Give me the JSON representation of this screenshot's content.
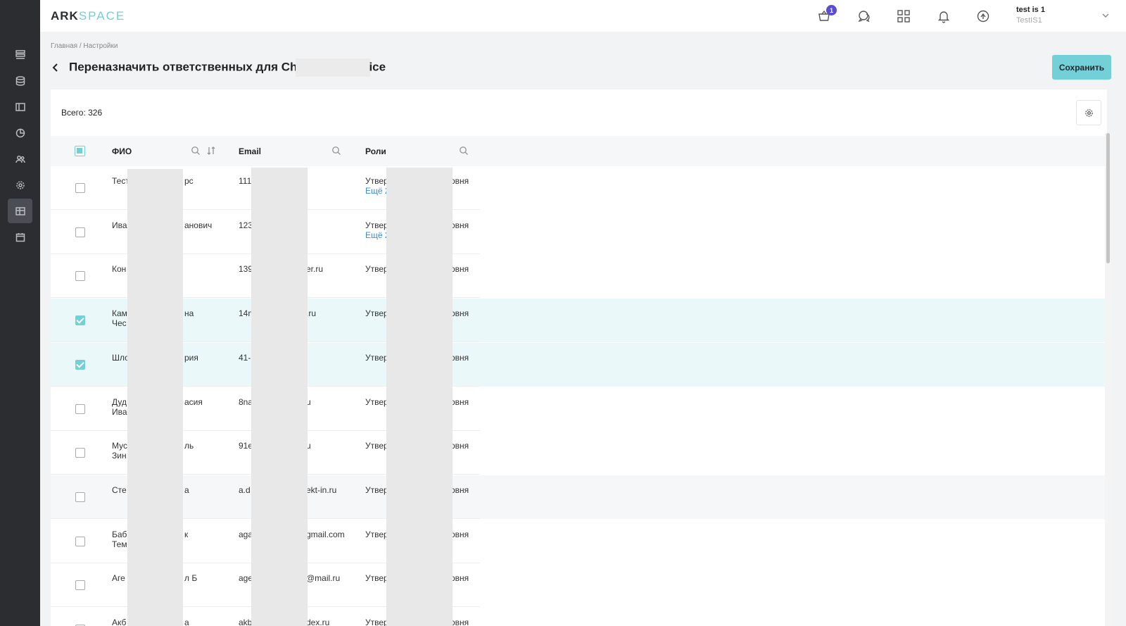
{
  "app": {
    "logo_ark": "ARK",
    "logo_space": "SPACE"
  },
  "topbar": {
    "cart_badge": "1",
    "user_name": "test is 1",
    "user_sub": "TestIS1",
    "icons": [
      "cart-icon",
      "chat-icon",
      "apps-grid-icon",
      "bell-icon",
      "sync-icon"
    ]
  },
  "breadcrumb": "Главная / Настройки",
  "page": {
    "title_start": "Переназначить ответственных для Ch",
    "title_end": "ice",
    "save_label": "Сохранить"
  },
  "table": {
    "total": "Всего: 326",
    "columns": {
      "name": "ФИО",
      "email": "Email",
      "roles": "Роли"
    },
    "rows": [
      {
        "name1": "Тест",
        "name2": "рс",
        "name3": "",
        "email1": "111",
        "email2": "",
        "role1": "Утвер",
        "role2": "овня",
        "more": "Ещё 2",
        "checked": false
      },
      {
        "name1": "Ива",
        "name2": "анович",
        "name3": "",
        "email1": "123",
        "email2": "",
        "role1": "Утвер",
        "role2": "овня",
        "more": "Ещё 2",
        "checked": false
      },
      {
        "name1": "Кон",
        "name2": "",
        "name3": "",
        "email1": "139",
        "email2": "er.ru",
        "role1": "Утвер",
        "role2": "овня",
        "more": "",
        "checked": false
      },
      {
        "name1": "Кам",
        "name2": "на",
        "name3": "Чес",
        "email1": "14n",
        "email2": ".ru",
        "role1": "Утвер",
        "role2": "овня",
        "more": "",
        "checked": true
      },
      {
        "name1": "Шло",
        "name2": "рия",
        "name3": "",
        "email1": "41-",
        "email2": "",
        "role1": "Утвер",
        "role2": "овня",
        "more": "",
        "checked": true
      },
      {
        "name1": "Дуд",
        "name2": "асия",
        "name3": "Ива",
        "email1": "8na",
        "email2": "u",
        "role1": "Утвер",
        "role2": "овня",
        "more": "",
        "checked": false
      },
      {
        "name1": "Мус",
        "name2": "ль",
        "name3": "Зин",
        "email1": "91e",
        "email2": "u",
        "role1": "Утвер",
        "role2": "овня",
        "more": "",
        "checked": false
      },
      {
        "name1": "Сте",
        "name2": "а",
        "name3": "",
        "email1": "a.d",
        "email2": "ekt-in.ru",
        "role1": "Утвер",
        "role2": "овня",
        "more": "",
        "checked": false
      },
      {
        "name1": "Баб",
        "name2": "к",
        "name3": "Тем",
        "email1": "aga",
        "email2": "gmail.com",
        "role1": "Утвер",
        "role2": "овня",
        "more": "",
        "checked": false
      },
      {
        "name1": "Аге",
        "name2": "л Б",
        "name3": "",
        "email1": "age",
        "email2": "@mail.ru",
        "role1": "Утвер",
        "role2": "овня",
        "more": "",
        "checked": false
      },
      {
        "name1": "Акб",
        "name2": "а",
        "name3": "",
        "email1": "akb",
        "email2": "dex.ru",
        "role1": "Утвер",
        "role2": "овня",
        "more": "",
        "checked": false
      }
    ]
  }
}
